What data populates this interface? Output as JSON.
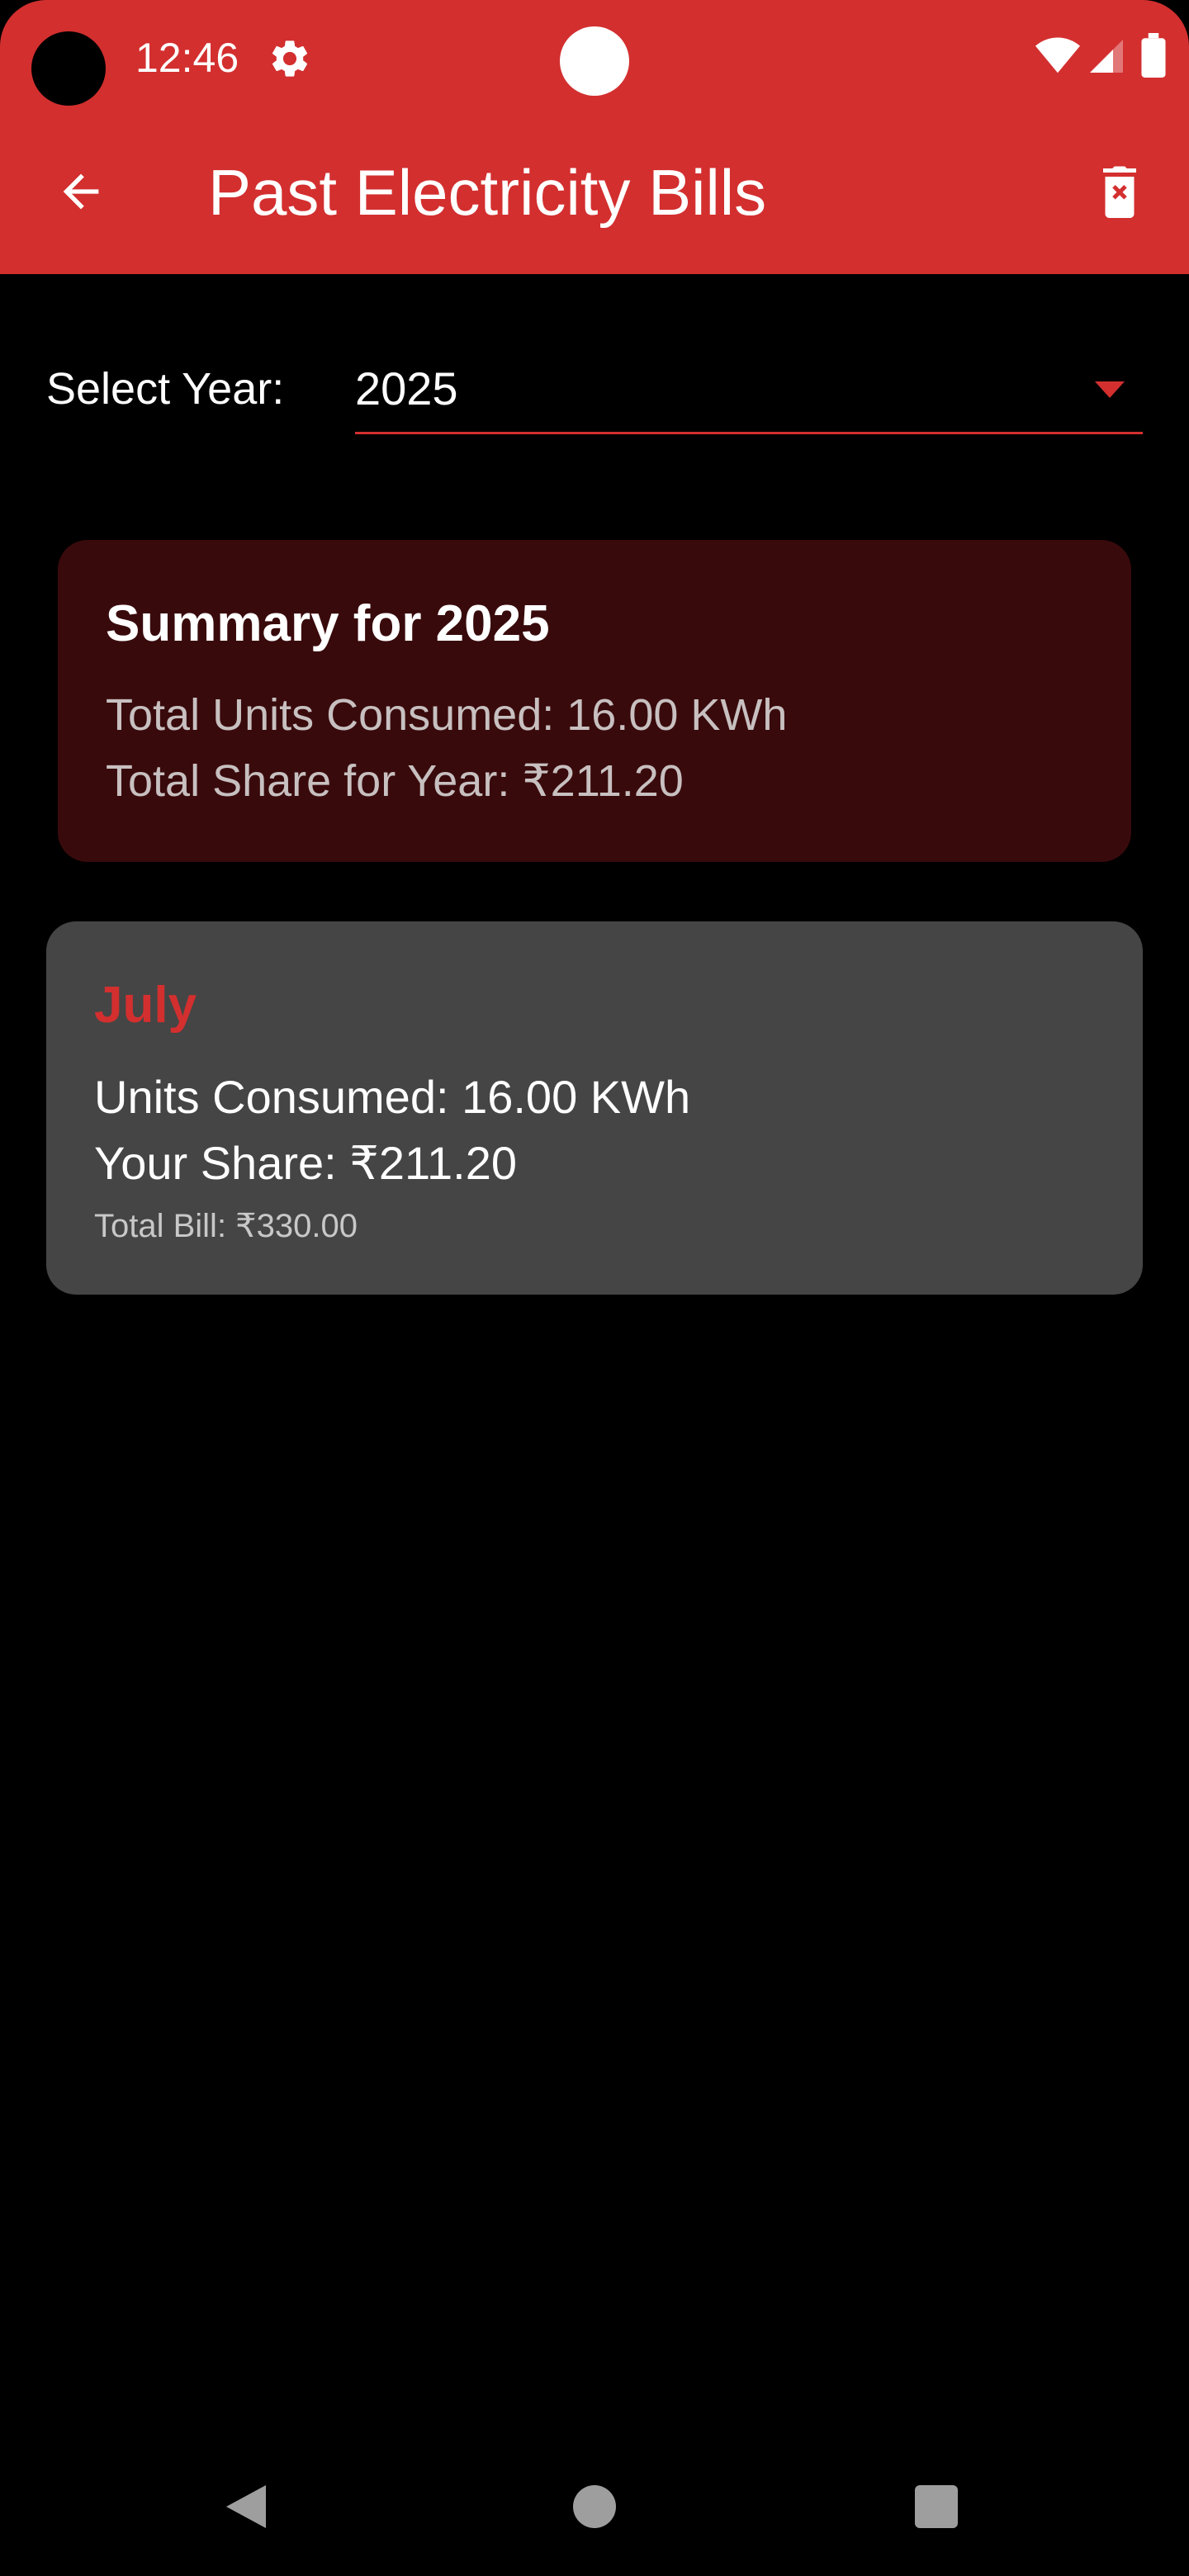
{
  "status_bar": {
    "time": "12:46"
  },
  "app_bar": {
    "title": "Past Electricity Bills",
    "back_icon": "arrow-left-icon",
    "delete_icon": "delete-forever-icon"
  },
  "year_selector": {
    "label": "Select Year:",
    "selected": "2025"
  },
  "summary": {
    "title": "Summary for 2025",
    "total_units": "Total Units Consumed: 16.00 KWh",
    "total_share": "Total Share for Year: ₹211.20"
  },
  "bills": [
    {
      "month": "July",
      "units": "Units Consumed: 16.00 KWh",
      "share": "Your Share: ₹211.20",
      "total": "Total Bill: ₹330.00"
    }
  ],
  "colors": {
    "accent": "#d32f2f",
    "summary_card_bg": "#390a0c",
    "bill_card_bg": "#454545",
    "background": "#000000"
  }
}
